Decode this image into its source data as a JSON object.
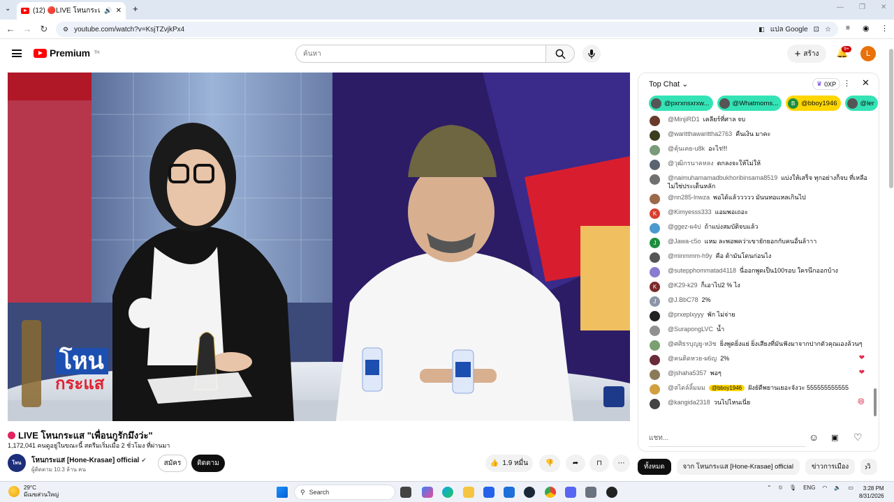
{
  "browser": {
    "tab_title": "(12) 🔴LIVE โหนกระแส \"เพื่อนกู",
    "url": "youtube.com/watch?v=KsjTZvjkPx4",
    "translate_label": "แปล Google"
  },
  "header": {
    "brand": "Premium",
    "brand_sup": "TH",
    "search_placeholder": "ค้นหา",
    "create_label": "สร้าง",
    "notif_count": "9+",
    "avatar_letter": "L"
  },
  "video": {
    "title": "LIVE โหนกระแส \"เพื่อนกูรักมึงว่ะ\"",
    "stats": "1,172,041 คนดูอยู่ในขณะนี้  สตรีมเริ่มเมื่อ 2 ชั่วโมง ที่ผ่านมา",
    "logo_text_1": "โหน",
    "logo_text_2": "กระแส"
  },
  "channel": {
    "name": "โหนกระแส [Hone-Krasae] official",
    "subs": "ผู้ติดตาม 10.3 ล้าน คน",
    "avatar_text": "โหน",
    "join_label": "สมัคร",
    "follow_label": "ติดตาม",
    "like_count": "1.9 หมื่น"
  },
  "chat": {
    "mode": "Top Chat",
    "xp_label": "0XP",
    "input_placeholder": "แชท...",
    "ticker": [
      {
        "name": "@pxrxnsxrxw...",
        "color": "#34e3b5"
      },
      {
        "name": "@Whatmoms...",
        "color": "#34e3b5"
      },
      {
        "name": "@bboy1946",
        "color": "#ffd600",
        "letter": "B"
      },
      {
        "name": "@ler",
        "color": "#34e3b5"
      }
    ],
    "messages": [
      {
        "author": "@MinjiRD1",
        "text": "เคลียร์ที่ศาล จบ",
        "av": "#6b3a2a"
      },
      {
        "author": "@waritthawarittha2763",
        "text": "คืนเงิน มาคะ",
        "av": "#3d3d1f"
      },
      {
        "author": "@คุ้นเคย-u8k",
        "text": "อะไร!!!",
        "av": "#7a9a7a"
      },
      {
        "author": "@วุฒิกรนาคหลง",
        "text": "ตกลงจะให้ไม่ให้",
        "av": "#5a6470"
      },
      {
        "author": "@naimuhamamadbukhoribinsama8519",
        "text": "แบ่งให้เสร็จ ทุกอย่างก็จบ ที่เหลือไม่ใช่ประเด็นหลัก",
        "av": "#707070",
        "wrap": true
      },
      {
        "author": "@nn285-lnwza",
        "text": "พอได้แล้ววววว มันนทอแหลเกินไป",
        "av": "#9a6a4a"
      },
      {
        "author": "@Kimyesss333",
        "text": "แอมพอเถอะ",
        "av": "#d6402f",
        "letter": "K"
      },
      {
        "author": "@ggez-ผ4ป",
        "text": "ถ้าแบ่งสมบัติจบแล้ว",
        "av": "#4a9ad0"
      },
      {
        "author": "@Jawa-c5o",
        "text": "แหม ละพอพคว่าเขายักยอกกับคนอื่นล้าาา",
        "av": "#1e8e3e",
        "letter": "J"
      },
      {
        "author": "@minmmm-h9y",
        "text": "คือ ต้ามันโดนก่อนไง",
        "av": "#555555"
      },
      {
        "author": "@sutepphommatad4118",
        "text": "นี่ออกพูดเป็น100รอบ ใครนึกออกบ้าง",
        "av": "#8a7ad0"
      },
      {
        "author": "@K29-k29",
        "text": "ก็เอาไป2 % ไง",
        "av": "#7a2a2a",
        "letter": "K"
      },
      {
        "author": "@J.BbC78",
        "text": "2%",
        "av": "#8a96a8",
        "letter": "J"
      },
      {
        "author": "@prxeplxyyy",
        "text": "พัก ไม่จ่าย",
        "av": "#222222"
      },
      {
        "author": "@SurapongLVC",
        "text": "น้ำ",
        "av": "#909090"
      },
      {
        "author": "@ศศิธรบุญยู-ห3ช",
        "text": "ยิ่งพูดยิ่งแย่ ยิ่งเสียงที่มันฟังมาจากปากตัวคุณเองล้วนๆ",
        "av": "#7aa070",
        "wrap": true
      },
      {
        "author": "@คนติดหวย-ผ6ญ",
        "text": "2%",
        "av": "#6a2a3a",
        "heart": true
      },
      {
        "author": "@jshaha5357",
        "text": "พอๆ",
        "av": "#8a7a5a",
        "heart": true
      },
      {
        "author": "@สไตล์ลิ้มมม",
        "text": "ฝังยัดีพยานเยอะจังวะ 555555555555",
        "av": "#d0a040",
        "mention": "@bboy1946"
      },
      {
        "author": "@kangida2318",
        "text": "วนไปไหนเนี่ย",
        "av": "#444444",
        "emoji": "😄"
      }
    ],
    "chips": [
      "ทั้งหมด",
      "จาก โหนกระแส [Hone-Krasae] official",
      "ข่าวการเมือง",
      "วิ"
    ]
  },
  "taskbar": {
    "temp": "29°C",
    "weather": "มีเมฆส่วนใหญ่",
    "search": "Search",
    "lang": "ENG",
    "time": "3:28 PM",
    "date": "8/31/2026"
  }
}
